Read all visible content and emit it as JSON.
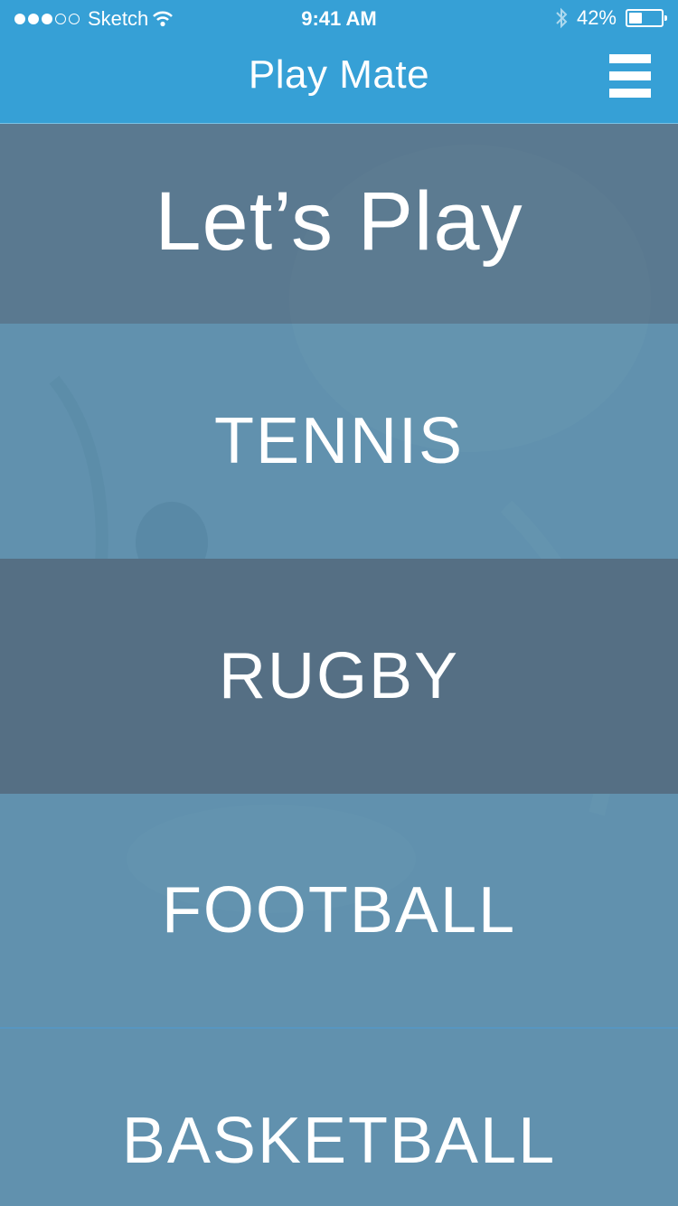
{
  "status_bar": {
    "carrier": "Sketch",
    "time": "9:41 AM",
    "battery_text": "42%",
    "battery_level": 0.42
  },
  "nav": {
    "title": "Play Mate",
    "menu_icon": "hamburger-menu-icon"
  },
  "hero": {
    "title": "Let’s Play"
  },
  "sports": [
    {
      "label": "TENNIS"
    },
    {
      "label": "RUGBY"
    },
    {
      "label": "FOOTBALL"
    },
    {
      "label": "BASKETBALL"
    }
  ],
  "colors": {
    "header": "#36a0d6",
    "hero_overlay": "#556e82",
    "row_overlay": "#5a8caa",
    "selected_row": "#556f84",
    "text": "#ffffff"
  }
}
